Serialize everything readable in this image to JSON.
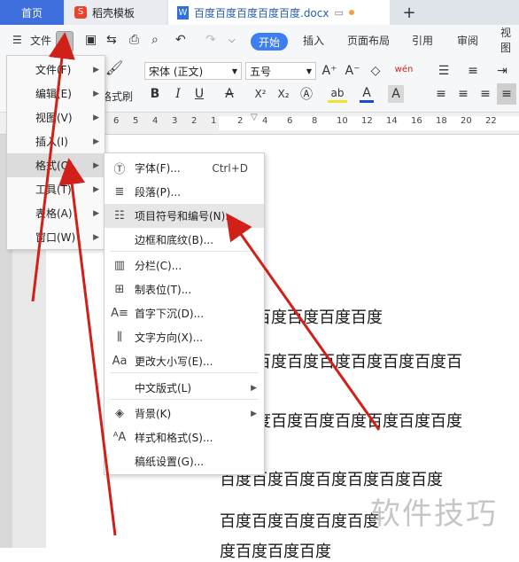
{
  "tabs": {
    "home": "首页",
    "template": "稻壳模板",
    "doc": "百度百度百度百度百度.docx",
    "add": "+"
  },
  "menubar": {
    "file": "文件",
    "start": "开始",
    "insert": "插入",
    "layout": "页面布局",
    "reference": "引用",
    "review": "审阅",
    "view": "视图"
  },
  "ribbon": {
    "font_name": "宋体 (正文)",
    "font_size": "五号",
    "format_brush": "格式刷",
    "bold": "B",
    "italic": "I",
    "underline": "U",
    "strike": "A",
    "superscript": "X²",
    "subscript": "X₂",
    "phonetic": "wén",
    "grow": "A⁺",
    "shrink": "A⁻"
  },
  "ruler": {
    "numbers_left": [
      "6",
      "5",
      "4",
      "3",
      "2",
      "1"
    ],
    "numbers_right": [
      "2",
      "4",
      "6",
      "8",
      "10",
      "12",
      "14",
      "16",
      "18",
      "20",
      "22"
    ]
  },
  "file_menu": {
    "items": [
      {
        "label": "文件(F)",
        "has_sub": true
      },
      {
        "label": "编辑(E)",
        "has_sub": true
      },
      {
        "label": "视图(V)",
        "has_sub": true
      },
      {
        "label": "插入(I)",
        "has_sub": true
      },
      {
        "label": "格式(O)",
        "has_sub": true,
        "selected": true
      },
      {
        "label": "工具(T)",
        "has_sub": true
      },
      {
        "label": "表格(A)",
        "has_sub": true
      },
      {
        "label": "窗口(W)",
        "has_sub": true
      }
    ]
  },
  "format_menu": {
    "items": [
      {
        "label": "字体(F)...",
        "shortcut": "Ctrl+D",
        "icon": "font-icon"
      },
      {
        "label": "段落(P)...",
        "icon": "paragraph-icon"
      },
      {
        "label": "项目符号和编号(N)...",
        "icon": "bullets-icon",
        "selected": true
      },
      {
        "label": "边框和底纹(B)...",
        "icon": ""
      },
      {
        "label": "分栏(C)...",
        "icon": "columns-icon"
      },
      {
        "label": "制表位(T)...",
        "icon": "tab-stop-icon"
      },
      {
        "label": "首字下沉(D)...",
        "icon": "drop-cap-icon"
      },
      {
        "label": "文字方向(X)...",
        "icon": "text-direction-icon"
      },
      {
        "label": "更改大小写(E)...",
        "icon": "change-case-icon"
      },
      {
        "label": "中文版式(L)",
        "icon": "",
        "has_sub": true
      },
      {
        "label": "背景(K)",
        "icon": "background-icon",
        "has_sub": true
      },
      {
        "label": "样式和格式(S)...",
        "icon": "styles-icon"
      },
      {
        "label": "稿纸设置(G)...",
        "icon": ""
      }
    ]
  },
  "document": {
    "lines": [
      "百度百度百度百度",
      "百度百度百度百度百度百度百",
      "度百度百度百度百度百度百度",
      "百度百度百度百度百度百度百度",
      "百度百度百度百度百度",
      "度百度百度百度"
    ]
  },
  "watermark": "软件技巧",
  "colors": {
    "accent": "#3d7ef0",
    "home_tab": "#3e6fdc",
    "annotation_arrow": "#d0201a"
  }
}
